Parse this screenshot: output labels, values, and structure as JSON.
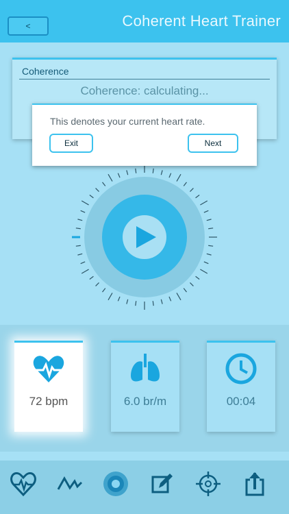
{
  "header": {
    "back_label": "<",
    "title": "Coherent Heart Trainer"
  },
  "coherence": {
    "title": "Coherence",
    "status": "Coherence: calculating..."
  },
  "tooltip": {
    "text": "This denotes your current heart rate.",
    "exit_label": "Exit",
    "next_label": "Next"
  },
  "metrics": [
    {
      "name": "heart-rate",
      "value": "72 bpm",
      "icon": "heart-pulse-icon"
    },
    {
      "name": "breathing-rate",
      "value": "6.0 br/m",
      "icon": "lungs-icon"
    },
    {
      "name": "session-time",
      "value": "00:04",
      "icon": "clock-icon"
    }
  ],
  "nav": [
    "heart-pulse-icon",
    "waveform-icon",
    "breathing-orb-icon",
    "edit-icon",
    "target-icon",
    "share-icon"
  ],
  "colors": {
    "header": "#3cc2ee",
    "background": "#a6e0f5",
    "accent": "#1aa6df"
  }
}
